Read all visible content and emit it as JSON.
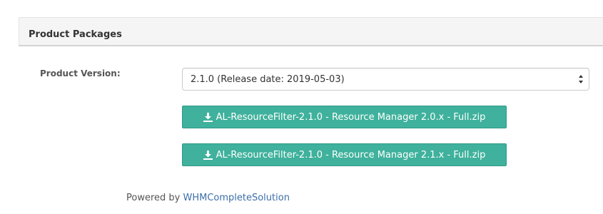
{
  "panel": {
    "title": "Product Packages"
  },
  "form": {
    "version_label": "Product Version:",
    "version_selected": "2.1.0 (Release date: 2019-05-03)"
  },
  "downloads": [
    {
      "label": "AL-ResourceFilter-2.1.0 - Resource Manager 2.0.x - Full.zip",
      "icon": "download-icon"
    },
    {
      "label": "AL-ResourceFilter-2.1.0 - Resource Manager 2.1.x - Full.zip",
      "icon": "download-icon"
    }
  ],
  "footer": {
    "prefix": "Powered by ",
    "link": "WHMCompleteSolution"
  },
  "colors": {
    "button_bg": "#3fb19c",
    "link": "#3b6fa8"
  }
}
